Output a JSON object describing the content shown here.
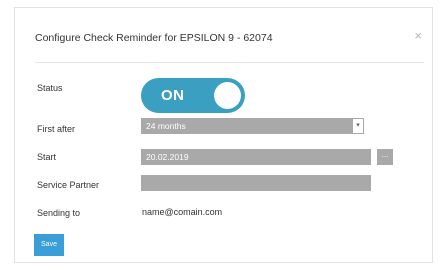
{
  "dialog": {
    "title": "Configure Check Reminder for EPSILON 9 - 62074",
    "close_symbol": "×"
  },
  "form": {
    "status": {
      "label": "Status",
      "toggle_text": "ON",
      "toggle_color": "#3a9fc1"
    },
    "first_after": {
      "label": "First after",
      "value": "24 months",
      "arrow": "▾"
    },
    "start": {
      "label": "Start",
      "value": "20.02.2019",
      "picker_label": "..."
    },
    "service_partner": {
      "label": "Service Partner",
      "value": ""
    },
    "sending_to": {
      "label": "Sending to",
      "value": "name@comain.com"
    }
  },
  "actions": {
    "save_label": "Save",
    "save_color": "#3a9fd9"
  }
}
